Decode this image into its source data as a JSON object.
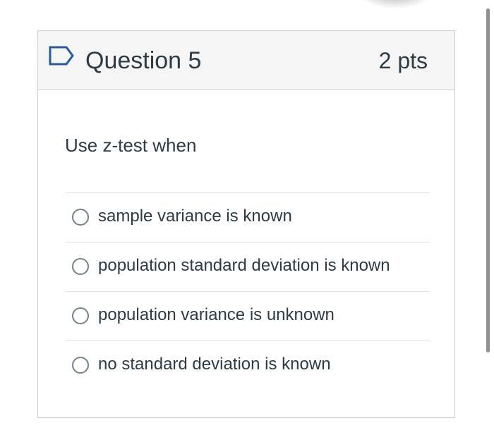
{
  "question": {
    "title": "Question 5",
    "points": "2 pts",
    "flag_icon": "flag-outline-icon",
    "prompt": "Use z-test when",
    "answers": [
      {
        "label": "sample variance is known",
        "selected": false
      },
      {
        "label": "population standard deviation is known",
        "selected": false
      },
      {
        "label": "population variance is unknown",
        "selected": false
      },
      {
        "label": "no standard deviation is known",
        "selected": false
      }
    ]
  },
  "colors": {
    "text": "#2d3b45",
    "header_bg": "#f5f5f5",
    "border": "#c7cdd1",
    "divider": "#dfe3e6",
    "flag": "#2d5b9a",
    "radio_border": "#73818a"
  }
}
